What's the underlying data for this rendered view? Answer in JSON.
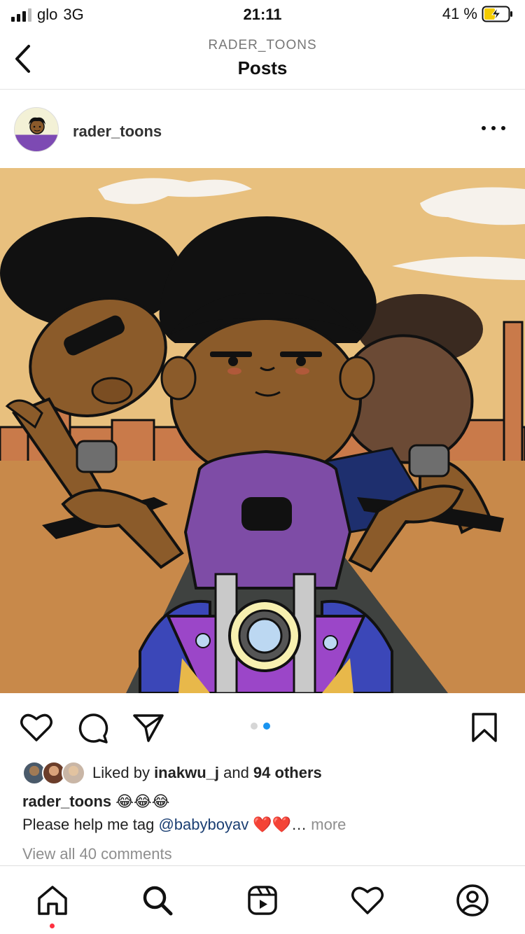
{
  "status_bar": {
    "carrier": "glo",
    "network": "3G",
    "time": "21:11",
    "battery": "41 %"
  },
  "header": {
    "account": "RADER_TOONS",
    "title": "Posts"
  },
  "post": {
    "username": "rader_toons",
    "carousel": {
      "total": 2,
      "active": 2
    },
    "likes": {
      "prefix": "Liked by ",
      "user": "inakwu_j",
      "middle": " and ",
      "others": "94 others"
    },
    "caption": {
      "username": "rader_toons",
      "emojis": "😂😂😂",
      "text": "Please help me tag ",
      "mention": "@babyboyav",
      "hearts": "❤️❤️",
      "ellipsis": "… ",
      "more": "more"
    },
    "comments_link": "View all 40 comments"
  },
  "colors": {
    "accent_blue": "#1a94f0",
    "notification_red": "#ff3040",
    "battery_yellow": "#f4cc00",
    "mention_blue": "#1b3f73"
  },
  "icons": {
    "actions": [
      "heart-icon",
      "comment-icon",
      "share-icon",
      "bookmark-icon"
    ],
    "tabs": [
      "home-icon",
      "search-icon",
      "reels-icon",
      "heart-icon",
      "profile-icon"
    ]
  }
}
